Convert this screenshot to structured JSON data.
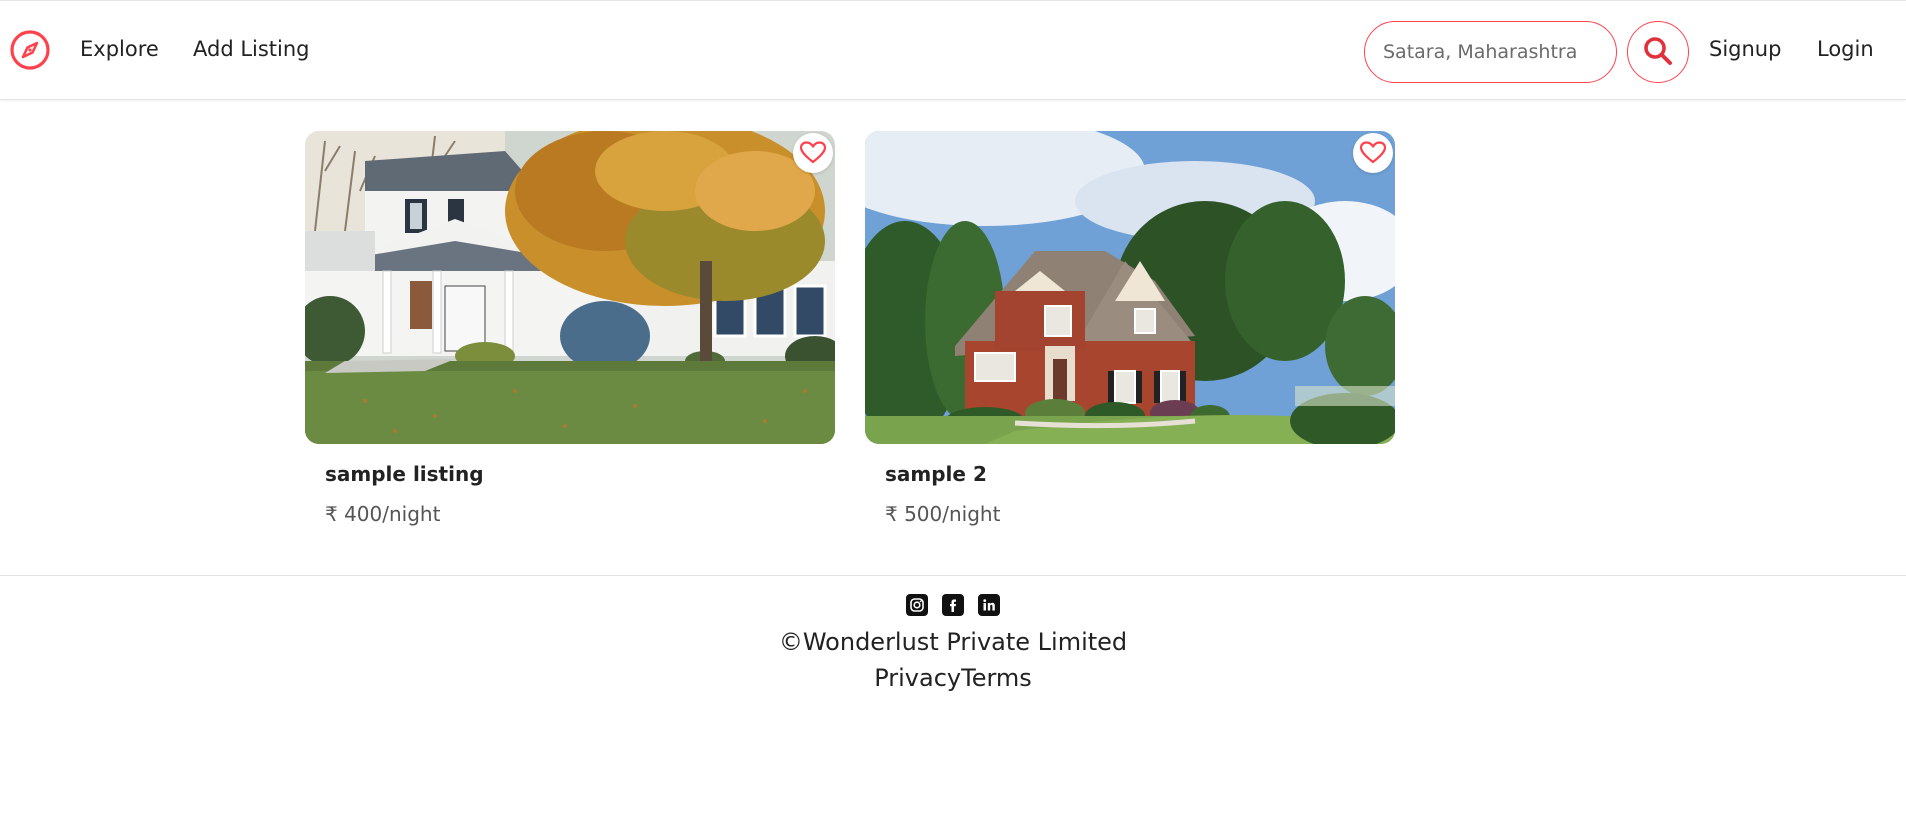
{
  "nav": {
    "brand_icon": "compass-icon",
    "explore": "Explore",
    "add_listing": "Add Listing",
    "signup": "Signup",
    "login": "Login",
    "search_placeholder": "Satara, Maharashtra",
    "search_icon": "search-icon"
  },
  "colors": {
    "accent": "#fe424d",
    "text": "#222222"
  },
  "listings": [
    {
      "title": "sample listing",
      "price": "₹ 400/night",
      "image": "white colonial house with autumn tree"
    },
    {
      "title": "sample 2",
      "price": "₹ 500/night",
      "image": "brick house with shingle roof and trees"
    }
  ],
  "footer": {
    "social_icons": [
      "instagram-icon",
      "facebook-icon",
      "linkedin-icon"
    ],
    "copyright": "©Wonderlust Private Limited",
    "privacy": "Privacy",
    "terms": "Terms"
  }
}
